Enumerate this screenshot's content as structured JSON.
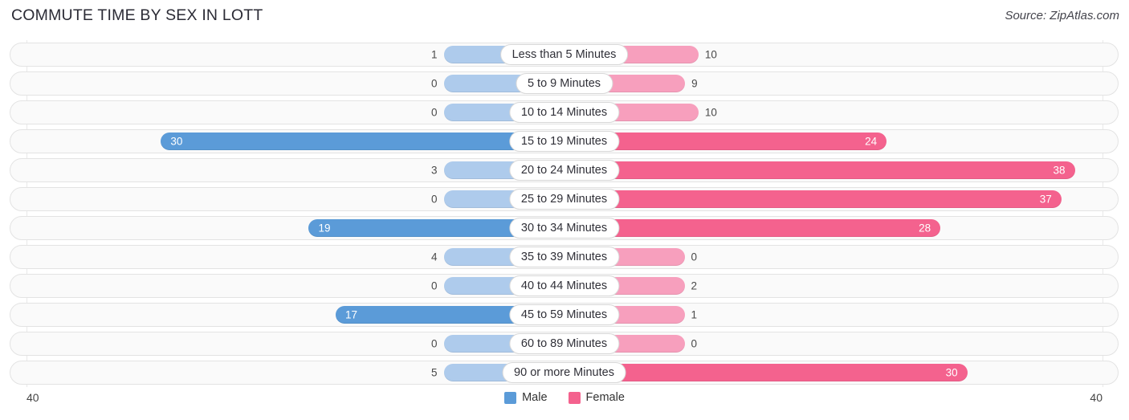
{
  "header": {
    "title": "COMMUTE TIME BY SEX IN LOTT",
    "source": "Source: ZipAtlas.com"
  },
  "legend": {
    "male_label": "Male",
    "female_label": "Female",
    "male_color": "#5b9bd8",
    "female_color": "#f4628e"
  },
  "axis": {
    "left_tick": "40",
    "right_tick": "40"
  },
  "colors": {
    "male_strong": "#5b9bd8",
    "male_light": "#aecbec",
    "female_strong": "#f4628e",
    "female_light": "#f79fbd",
    "track_fill": "#fafafa",
    "track_border": "#e3e3e3"
  },
  "chart_data": {
    "type": "bar",
    "orientation": "horizontal-diverging",
    "title": "COMMUTE TIME BY SEX IN LOTT",
    "xlabel": "",
    "ylabel": "",
    "xlim": [
      40,
      40
    ],
    "axis_max": 40,
    "grid": true,
    "legend_position": "bottom-center",
    "categories": [
      "Less than 5 Minutes",
      "5 to 9 Minutes",
      "10 to 14 Minutes",
      "15 to 19 Minutes",
      "20 to 24 Minutes",
      "25 to 29 Minutes",
      "30 to 34 Minutes",
      "35 to 39 Minutes",
      "40 to 44 Minutes",
      "45 to 59 Minutes",
      "60 to 89 Minutes",
      "90 or more Minutes"
    ],
    "series": [
      {
        "name": "Male",
        "color": "#5b9bd8",
        "values": [
          1,
          0,
          0,
          30,
          3,
          0,
          19,
          4,
          0,
          17,
          0,
          5
        ]
      },
      {
        "name": "Female",
        "color": "#f4628e",
        "values": [
          10,
          9,
          10,
          24,
          38,
          37,
          28,
          0,
          2,
          1,
          0,
          30
        ]
      }
    ]
  },
  "rows": [
    {
      "label": "Less than 5 Minutes",
      "male": 1,
      "female": 10
    },
    {
      "label": "5 to 9 Minutes",
      "male": 0,
      "female": 9
    },
    {
      "label": "10 to 14 Minutes",
      "male": 0,
      "female": 10
    },
    {
      "label": "15 to 19 Minutes",
      "male": 30,
      "female": 24
    },
    {
      "label": "20 to 24 Minutes",
      "male": 3,
      "female": 38
    },
    {
      "label": "25 to 29 Minutes",
      "male": 0,
      "female": 37
    },
    {
      "label": "30 to 34 Minutes",
      "male": 19,
      "female": 28
    },
    {
      "label": "35 to 39 Minutes",
      "male": 4,
      "female": 0
    },
    {
      "label": "40 to 44 Minutes",
      "male": 0,
      "female": 2
    },
    {
      "label": "45 to 59 Minutes",
      "male": 17,
      "female": 1
    },
    {
      "label": "60 to 89 Minutes",
      "male": 0,
      "female": 0
    },
    {
      "label": "90 or more Minutes",
      "male": 5,
      "female": 30
    }
  ]
}
